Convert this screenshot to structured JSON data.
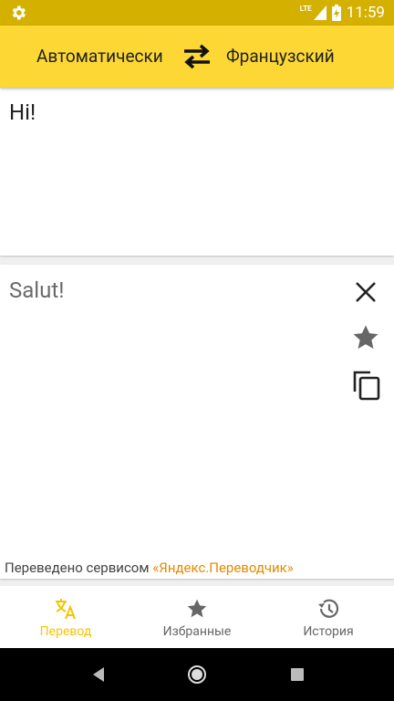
{
  "status_bar": {
    "time": "11:59",
    "network": "LTE",
    "icons": [
      "gear-icon",
      "signal-icon",
      "battery-icon"
    ]
  },
  "toolbar": {
    "source_language": "Автоматически",
    "target_language": "Французский",
    "swap_icon": "swap-arrows-icon"
  },
  "input": {
    "text": "Hi!"
  },
  "output": {
    "text": "Salut!",
    "actions": [
      "close-icon",
      "star-icon",
      "copy-icon"
    ],
    "attribution_prefix": "Переведено сервисом",
    "attribution_link": "«Яндекс.Переводчик»"
  },
  "bottom_nav": {
    "items": [
      {
        "label": "Перевод",
        "icon": "translate-icon",
        "active": true
      },
      {
        "label": "Избранные",
        "icon": "star-icon",
        "active": false
      },
      {
        "label": "История",
        "icon": "history-icon",
        "active": false
      }
    ]
  },
  "colors": {
    "accent": "#fdd835",
    "status_bar": "#d4b000",
    "active_tab": "#f6c400",
    "link": "#e48a00"
  }
}
